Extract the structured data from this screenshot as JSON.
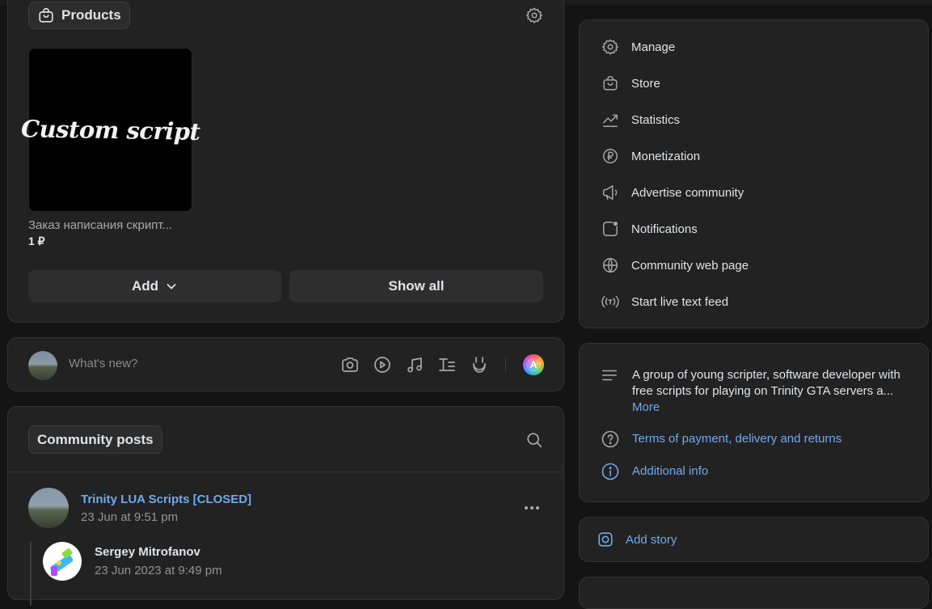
{
  "products": {
    "title": "Products",
    "item": {
      "image_text": "Custom script",
      "name": "Заказ написания скрипт...",
      "price": "1 ₽"
    },
    "add_label": "Add",
    "show_all_label": "Show all"
  },
  "composer": {
    "placeholder": "What's new?"
  },
  "posts": {
    "title": "Community posts",
    "post": {
      "author": "Trinity LUA Scripts [CLOSED]",
      "time": "23 Jun at 9:51 pm",
      "repost_author": "Sergey Mitrofanov",
      "repost_time": "23 Jun 2023 at 9:49 pm"
    }
  },
  "sidebar": {
    "items": [
      {
        "label": "Manage",
        "icon": "gear-icon"
      },
      {
        "label": "Store",
        "icon": "bag-icon"
      },
      {
        "label": "Statistics",
        "icon": "chart-icon"
      },
      {
        "label": "Monetization",
        "icon": "ruble-icon"
      },
      {
        "label": "Advertise community",
        "icon": "megaphone-icon"
      },
      {
        "label": "Notifications",
        "icon": "notification-icon"
      },
      {
        "label": "Community web page",
        "icon": "globe-icon"
      },
      {
        "label": "Start live text feed",
        "icon": "broadcast-icon"
      }
    ]
  },
  "about": {
    "description": "A group of young scripter, software developer with free scripts for playing on Trinity GTA servers a...",
    "more": "More",
    "terms": "Terms of payment, delivery and returns",
    "additional": "Additional info"
  },
  "story": {
    "label": "Add story"
  },
  "colors": {
    "background": "#141414",
    "card": "#222222",
    "link": "#71aaeb",
    "text": "#e1e3e6",
    "muted": "#939393"
  }
}
